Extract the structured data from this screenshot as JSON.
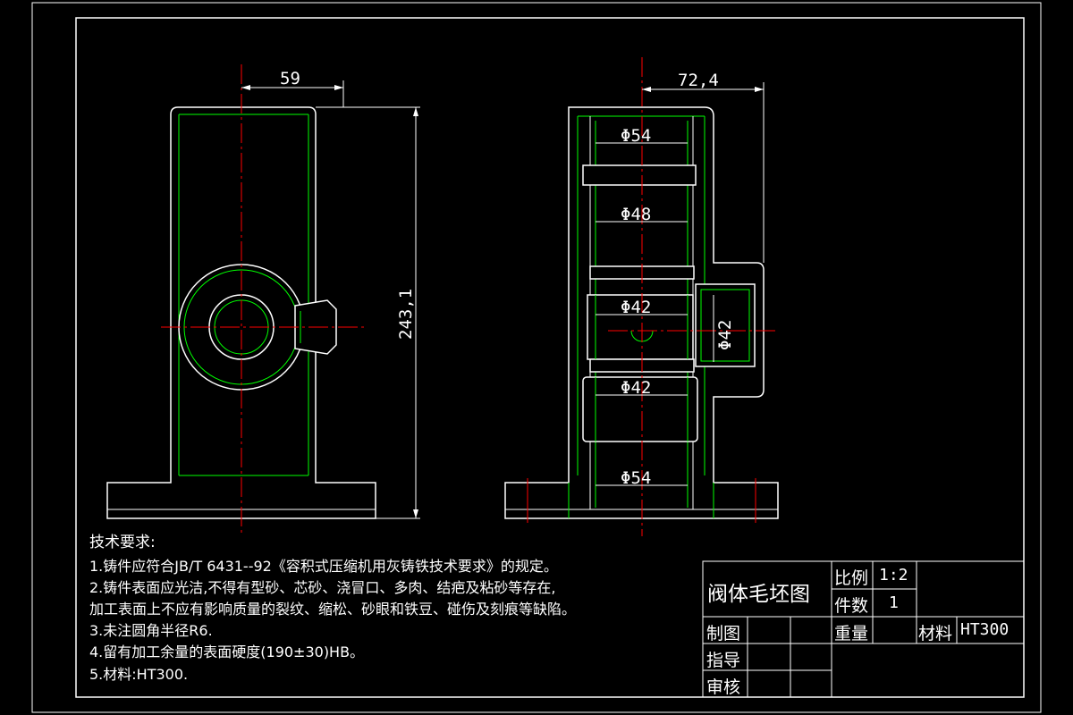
{
  "dimensions": {
    "front_width": "59",
    "front_height": "243,1",
    "side_width": "72,4",
    "d1": "Φ54",
    "d2": "Φ48",
    "d3": "Φ42",
    "d4": "Φ42",
    "d5": "Φ54",
    "d6": "Φ42"
  },
  "requirements": {
    "title": "技术要求:",
    "items": [
      "1.铸件应符合JB/T  6431--92《容积式压缩机用灰铸铁技术要求》的规定。",
      "2.铸件表面应光洁,不得有型砂、芯砂、浇冒口、多肉、结疤及粘砂等存在,",
      "   加工表面上不应有影响质量的裂纹、缩松、砂眼和铁豆、碰伤及刻痕等缺陷。",
      "3.未注圆角半径R6.",
      "4.留有加工余量的表面硬度(190±30)HB。",
      "5.材料:HT300."
    ]
  },
  "title_block": {
    "part_name": "阀体毛坯图",
    "scale_label": "比例",
    "scale_value": "1:2",
    "quantity_label": "件数",
    "quantity_value": "1",
    "weight_label": "重量",
    "material_label": "材料",
    "material_value": "HT300",
    "drawn_label": "制图",
    "guide_label": "指导",
    "review_label": "审核"
  },
  "colors": {
    "background": "#000000",
    "outline": "#ffffff",
    "hidden": "#00ff00",
    "centerline": "#ff0000"
  }
}
